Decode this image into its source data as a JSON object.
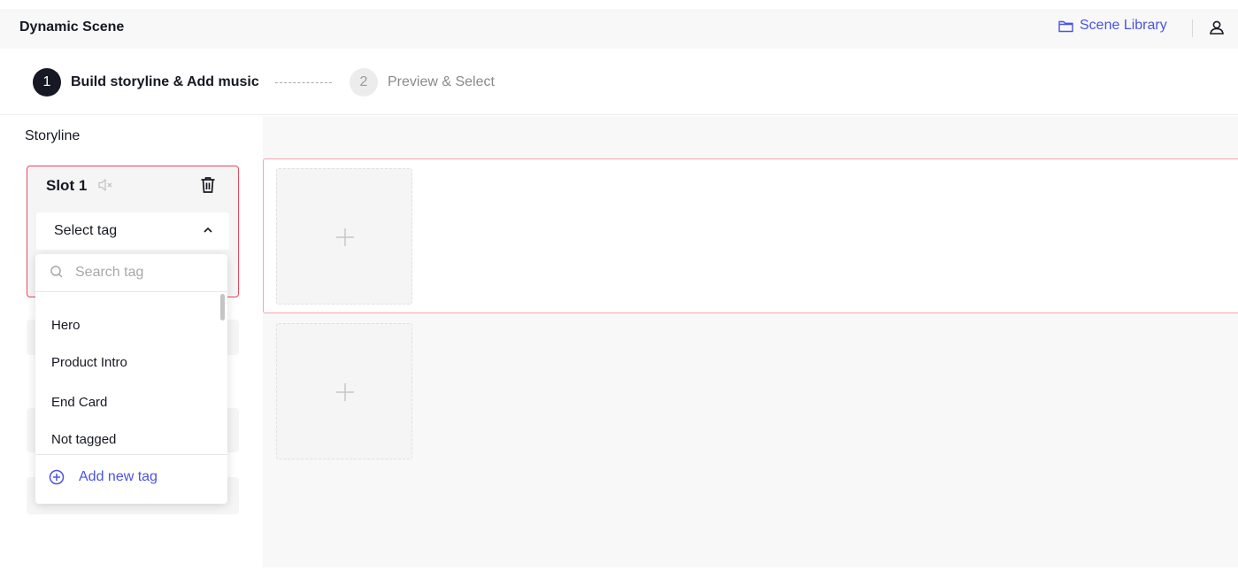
{
  "header": {
    "title": "Dynamic Scene",
    "scene_library_label": "Scene Library"
  },
  "steps": [
    {
      "number": "1",
      "label": "Build storyline & Add music",
      "active": true
    },
    {
      "number": "2",
      "label": "Preview & Select",
      "active": false
    }
  ],
  "storyline": {
    "heading": "Storyline",
    "slot": {
      "title": "Slot 1",
      "select_label": "Select tag"
    }
  },
  "dropdown": {
    "search_placeholder": "Search tag",
    "options": [
      "Hero",
      "Product Intro",
      "End Card",
      "Not tagged"
    ],
    "add_new_label": "Add new tag"
  },
  "colors": {
    "accent": "#4a53e6",
    "active_border": "#e8475e",
    "text": "#161823"
  },
  "icons": {
    "scene_library": "folder-icon",
    "account": "person-icon",
    "mute": "speaker-muted-icon",
    "delete": "trash-icon",
    "select": "chevron-up-icon",
    "search": "search-icon",
    "add_new": "plus-circle-icon",
    "add_clip": "plus-icon"
  }
}
